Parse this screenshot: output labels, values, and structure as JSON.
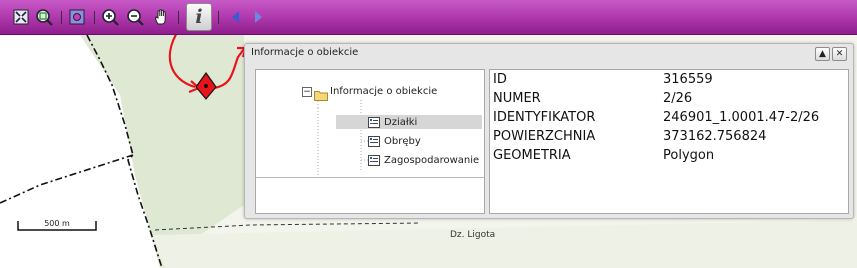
{
  "toolbar": {
    "tools": [
      "full-extent-icon",
      "zoom-window-icon",
      "zoom-previous-icon",
      "zoom-in-icon",
      "zoom-out-icon",
      "pan-hand-icon",
      "identify-info-icon",
      "back-arrow-icon",
      "forward-arrow-icon"
    ],
    "info_glyph": "i",
    "colors": {
      "bar_top": "#c75ac6",
      "bar_bottom": "#8f1d8d"
    }
  },
  "map": {
    "scale_label": "500 m",
    "place_label": "Dz. Ligota",
    "marker_color": "#e8141c",
    "arrow_color": "#e8141c"
  },
  "window": {
    "title": "Informacje o obiekcie",
    "collapse_glyph": "▲",
    "close_glyph": "✕",
    "tree": {
      "expander": "−",
      "root_label": "Informacje o obiekcie",
      "nodes": [
        {
          "label": "Działki",
          "selected": true
        },
        {
          "label": "Obręby",
          "selected": false
        },
        {
          "label": "Zagospodarowanie",
          "selected": false
        }
      ]
    },
    "attributes": [
      {
        "key": "ID",
        "value": "316559"
      },
      {
        "key": "NUMER",
        "value": "2/26"
      },
      {
        "key": "IDENTYFIKATOR",
        "value": "246901_1.0001.47-2/26"
      },
      {
        "key": "POWIERZCHNIA",
        "value": "373162.756824"
      },
      {
        "key": "GEOMETRIA",
        "value": "Polygon"
      }
    ]
  }
}
